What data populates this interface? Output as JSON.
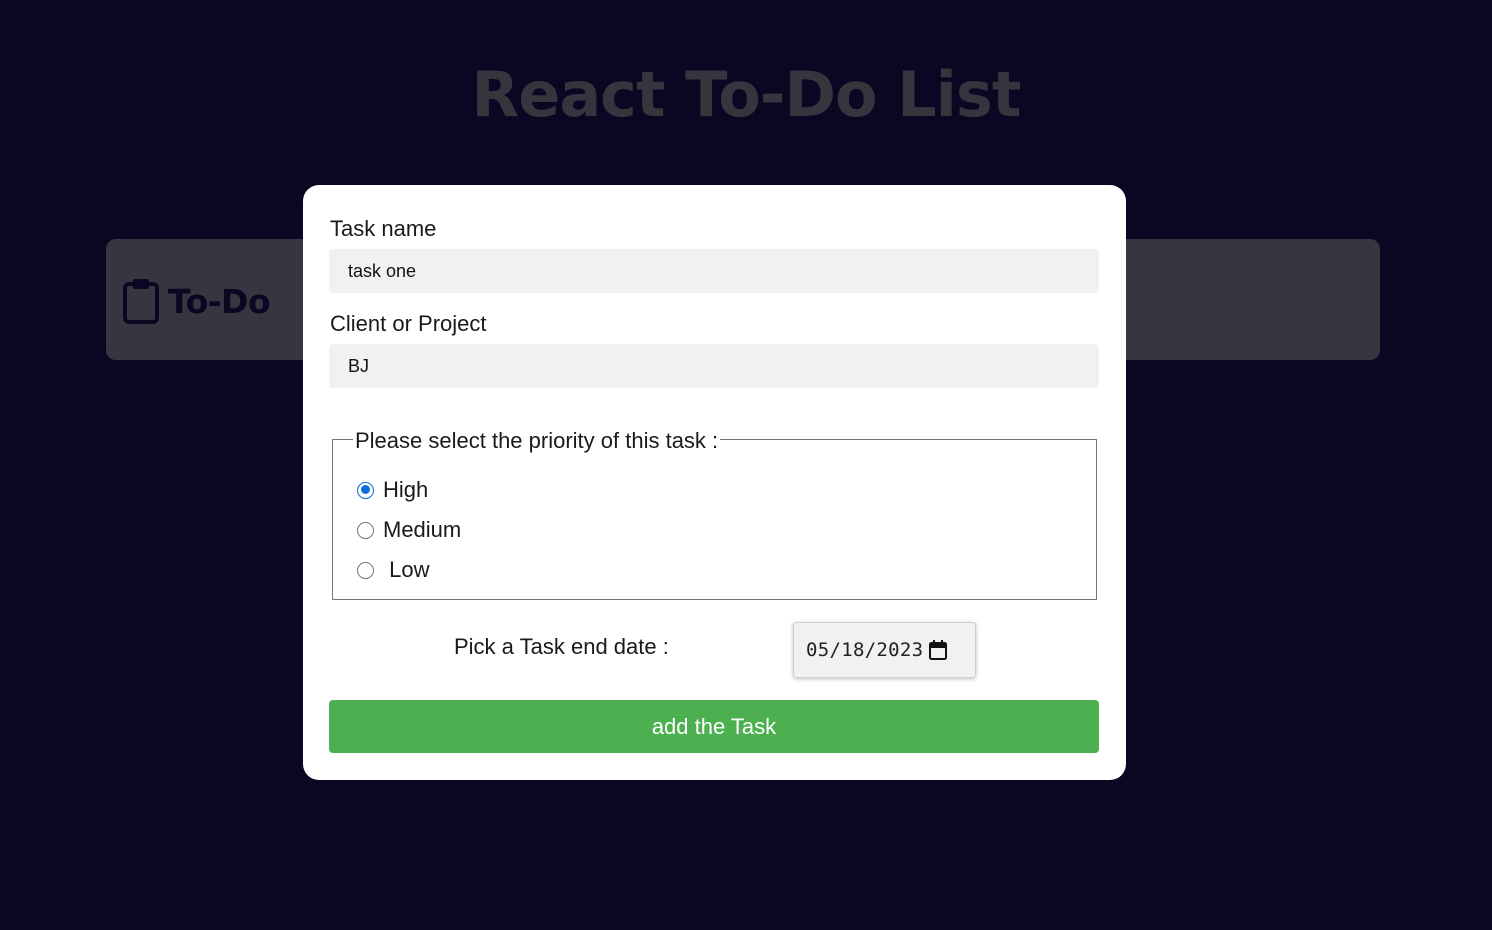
{
  "app": {
    "title": "React To-Do List"
  },
  "board": {
    "todo_column": {
      "label": "To-Do",
      "icon": "clipboard-icon"
    }
  },
  "modal": {
    "task_name": {
      "label": "Task name",
      "value": "task one"
    },
    "client": {
      "label": "Client or Project",
      "value": "BJ"
    },
    "priority": {
      "legend": "Please select the priority of this task :",
      "options": [
        {
          "label": "High",
          "checked": true
        },
        {
          "label": "Medium",
          "checked": false
        },
        {
          "label": " Low",
          "checked": false
        }
      ]
    },
    "end_date": {
      "label": "Pick a Task end date :",
      "value": "05/18/2023",
      "icon": "calendar-icon"
    },
    "submit": {
      "label": "add the Task",
      "color": "#4caf50"
    }
  },
  "colors": {
    "background": "#090722",
    "column": "#37353f",
    "radio_accent": "#0a6ee0"
  }
}
